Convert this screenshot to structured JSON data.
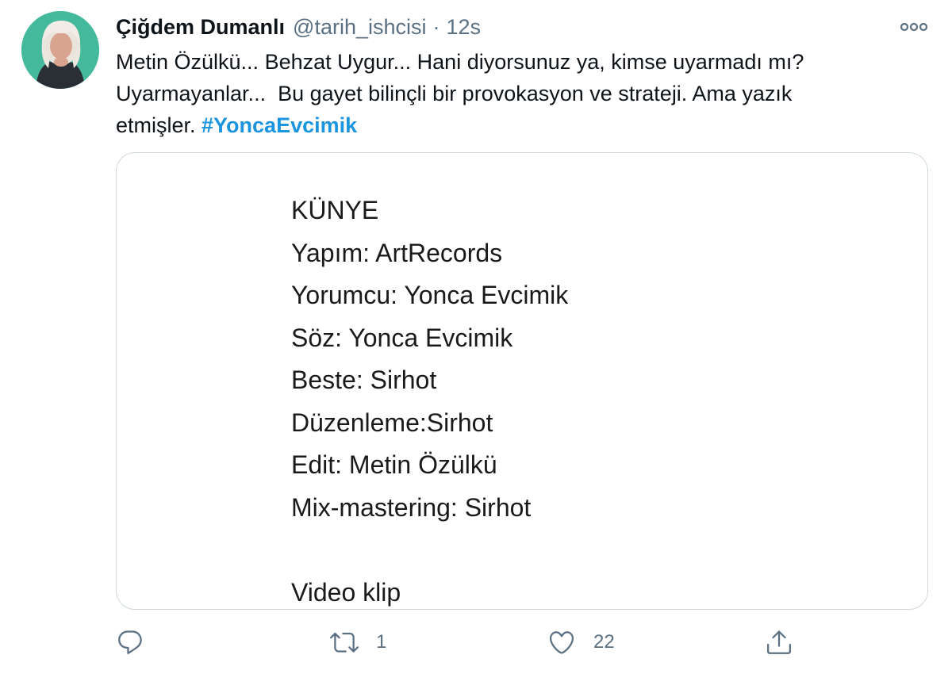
{
  "tweet": {
    "author": {
      "name": "Çiğdem Dumanlı",
      "handle": "@tarih_ishcisi",
      "avatar_icon": "profile-photo"
    },
    "separator": "·",
    "timestamp": "12s",
    "text_lines": [
      "Metin Özülkü... Behzat Uygur... Hani diyorsunuz ya, kimse uyarmadı mı?",
      "Uyarmayanlar...  Bu gayet bilinçli bir provokasyon ve strateji. Ama yazık",
      "etmişler. "
    ],
    "hashtag": "#YoncaEvcimik",
    "media": {
      "credit_lines": [
        "KÜNYE",
        "Yapım: ArtRecords",
        "Yorumcu: Yonca Evcimik",
        "Söz: Yonca Evcimik",
        "Beste: Sirhot",
        "Düzenleme:Sirhot",
        "Edit: Metin Özülkü",
        "Mix-mastering: Sirhot",
        "",
        "Video klip"
      ]
    },
    "actions": {
      "reply": {
        "icon": "reply-icon",
        "count": ""
      },
      "retweet": {
        "icon": "retweet-icon",
        "count": "1"
      },
      "like": {
        "icon": "heart-icon",
        "count": "22"
      },
      "share": {
        "icon": "share-icon",
        "count": ""
      }
    },
    "more_icon": "more-options-icon"
  },
  "colors": {
    "text_primary": "#0f1419",
    "text_secondary": "#5b7083",
    "hashtag": "#1b95e0",
    "border": "#cfd9de",
    "avatar_bg": "#3fb79a"
  }
}
